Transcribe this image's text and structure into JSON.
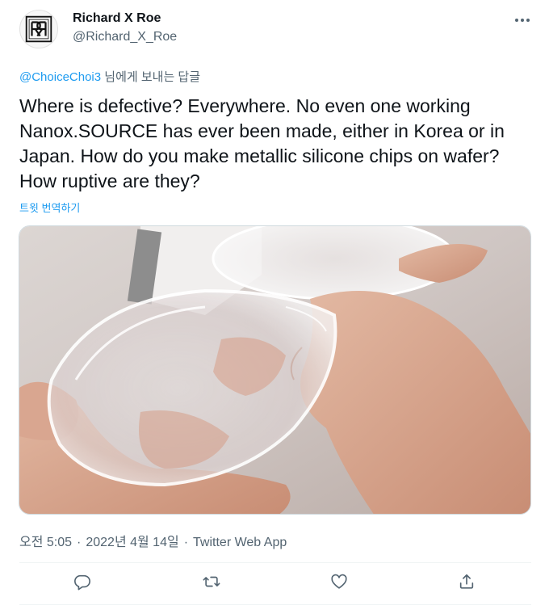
{
  "author": {
    "name": "Richard X Roe",
    "handle": "@Richard_X_Roe",
    "avatar_icon": "rxr-monogram-logo"
  },
  "reply_context": {
    "mention": "@ChoiceChoi3",
    "suffix": " 님에게 보내는 답글"
  },
  "tweet": {
    "text": "Where is defective?  Everywhere.  No even one working Nanox.SOURCE has ever been made, either in Korea or in Japan.  How do you make metallic silicone chips on wafer?  How ruptive are they?",
    "translate_label": "트윗 번역하기"
  },
  "meta": {
    "time": "오전 5:05",
    "date": "2022년 4월 14일",
    "source": "Twitter Web App",
    "separator": "·"
  },
  "actions": [
    {
      "icon": "reply-icon"
    },
    {
      "icon": "retweet-icon"
    },
    {
      "icon": "like-icon"
    },
    {
      "icon": "share-icon"
    }
  ],
  "colors": {
    "accent": "#1d9bf0",
    "secondary_text": "#536471",
    "primary_text": "#0f1419"
  }
}
